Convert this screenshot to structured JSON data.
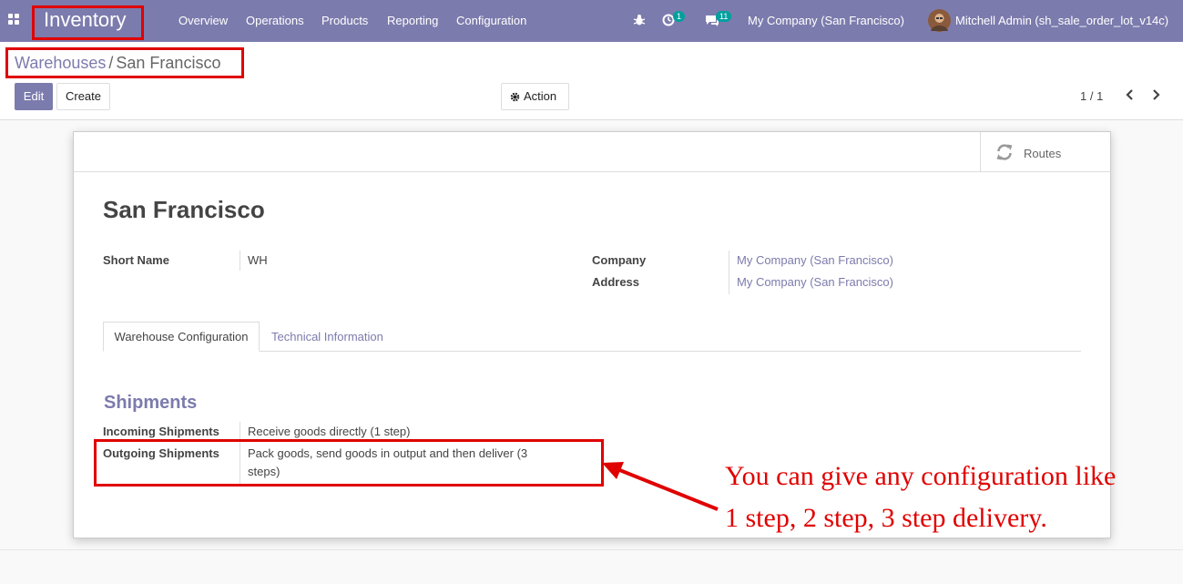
{
  "navbar": {
    "app_name": "Inventory",
    "menu": [
      "Overview",
      "Operations",
      "Products",
      "Reporting",
      "Configuration"
    ],
    "activity_count": "1",
    "message_count": "11",
    "company": "My Company (San Francisco)",
    "user": "Mitchell Admin (sh_sale_order_lot_v14c)"
  },
  "breadcrumb": {
    "parent": "Warehouses",
    "separator": "/",
    "current": "San Francisco"
  },
  "toolbar": {
    "edit_label": "Edit",
    "create_label": "Create",
    "action_label": "Action",
    "pager": "1 / 1"
  },
  "form": {
    "routes_label": "Routes",
    "title": "San Francisco",
    "short_name_label": "Short Name",
    "short_name": "WH",
    "company_label": "Company",
    "company": "My Company (San Francisco)",
    "address_label": "Address",
    "address": "My Company (San Francisco)",
    "tabs": [
      "Warehouse Configuration",
      "Technical Information"
    ],
    "section_title": "Shipments",
    "incoming_label": "Incoming Shipments",
    "incoming_value": "Receive goods directly (1 step)",
    "outgoing_label": "Outgoing Shipments",
    "outgoing_value_line1": "Pack goods, send goods in output and then deliver (3",
    "outgoing_value_line2": "steps)"
  },
  "annotation": {
    "line1": "You can give any configuration like",
    "line2": "1 step, 2 step, 3 step delivery."
  },
  "colors": {
    "brand": "#7c7bad",
    "highlight": "#e00000",
    "badge": "#00a09d"
  },
  "icons": [
    "apps-icon",
    "bug-icon",
    "clock-icon",
    "chat-icon",
    "avatar",
    "gear-icon",
    "chevron-left-icon",
    "chevron-right-icon",
    "refresh-icon",
    "arrow-icon"
  ]
}
